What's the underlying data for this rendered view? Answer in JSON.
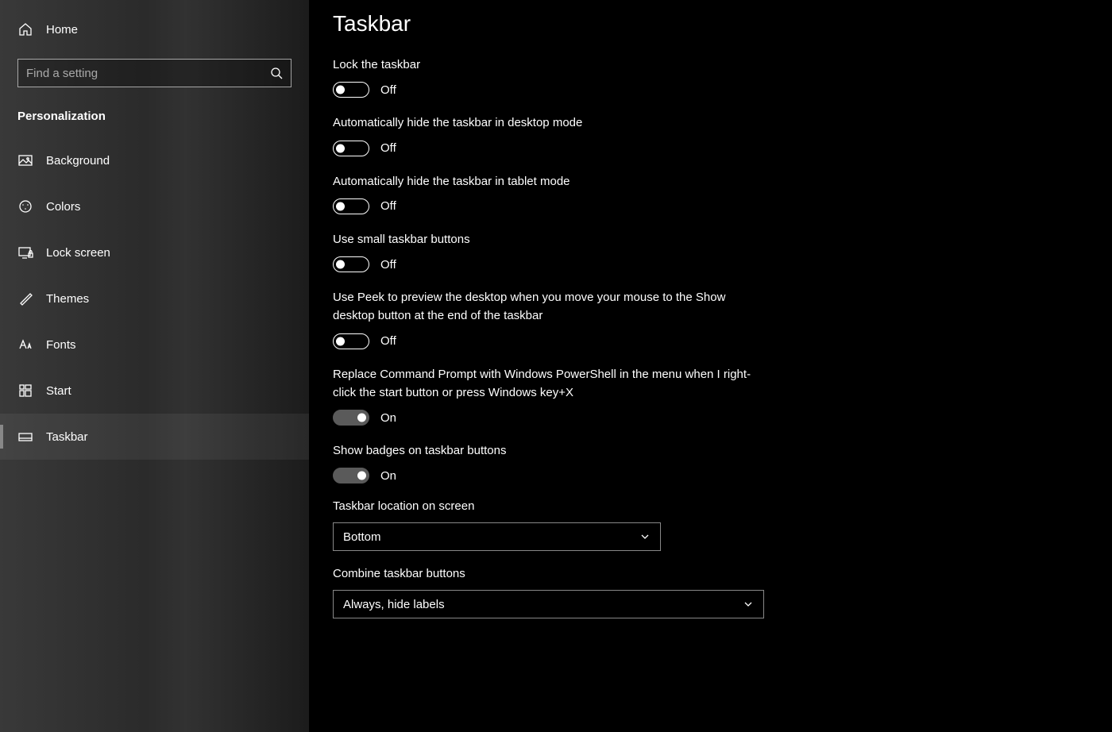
{
  "sidebar": {
    "home_label": "Home",
    "search_placeholder": "Find a setting",
    "category": "Personalization",
    "items": [
      {
        "label": "Background"
      },
      {
        "label": "Colors"
      },
      {
        "label": "Lock screen"
      },
      {
        "label": "Themes"
      },
      {
        "label": "Fonts"
      },
      {
        "label": "Start"
      },
      {
        "label": "Taskbar"
      }
    ]
  },
  "main": {
    "title": "Taskbar",
    "toggles": [
      {
        "label": "Lock the taskbar",
        "on": false,
        "state": "Off"
      },
      {
        "label": "Automatically hide the taskbar in desktop mode",
        "on": false,
        "state": "Off"
      },
      {
        "label": "Automatically hide the taskbar in tablet mode",
        "on": false,
        "state": "Off"
      },
      {
        "label": "Use small taskbar buttons",
        "on": false,
        "state": "Off"
      },
      {
        "label": "Use Peek to preview the desktop when you move your mouse to the Show desktop button at the end of the taskbar",
        "on": false,
        "state": "Off"
      },
      {
        "label": "Replace Command Prompt with Windows PowerShell in the menu when I right-click the start button or press Windows key+X",
        "on": true,
        "state": "On"
      },
      {
        "label": "Show badges on taskbar buttons",
        "on": true,
        "state": "On"
      }
    ],
    "selects": [
      {
        "label": "Taskbar location on screen",
        "value": "Bottom",
        "width": "narrow"
      },
      {
        "label": "Combine taskbar buttons",
        "value": "Always, hide labels",
        "width": "wide"
      }
    ]
  }
}
